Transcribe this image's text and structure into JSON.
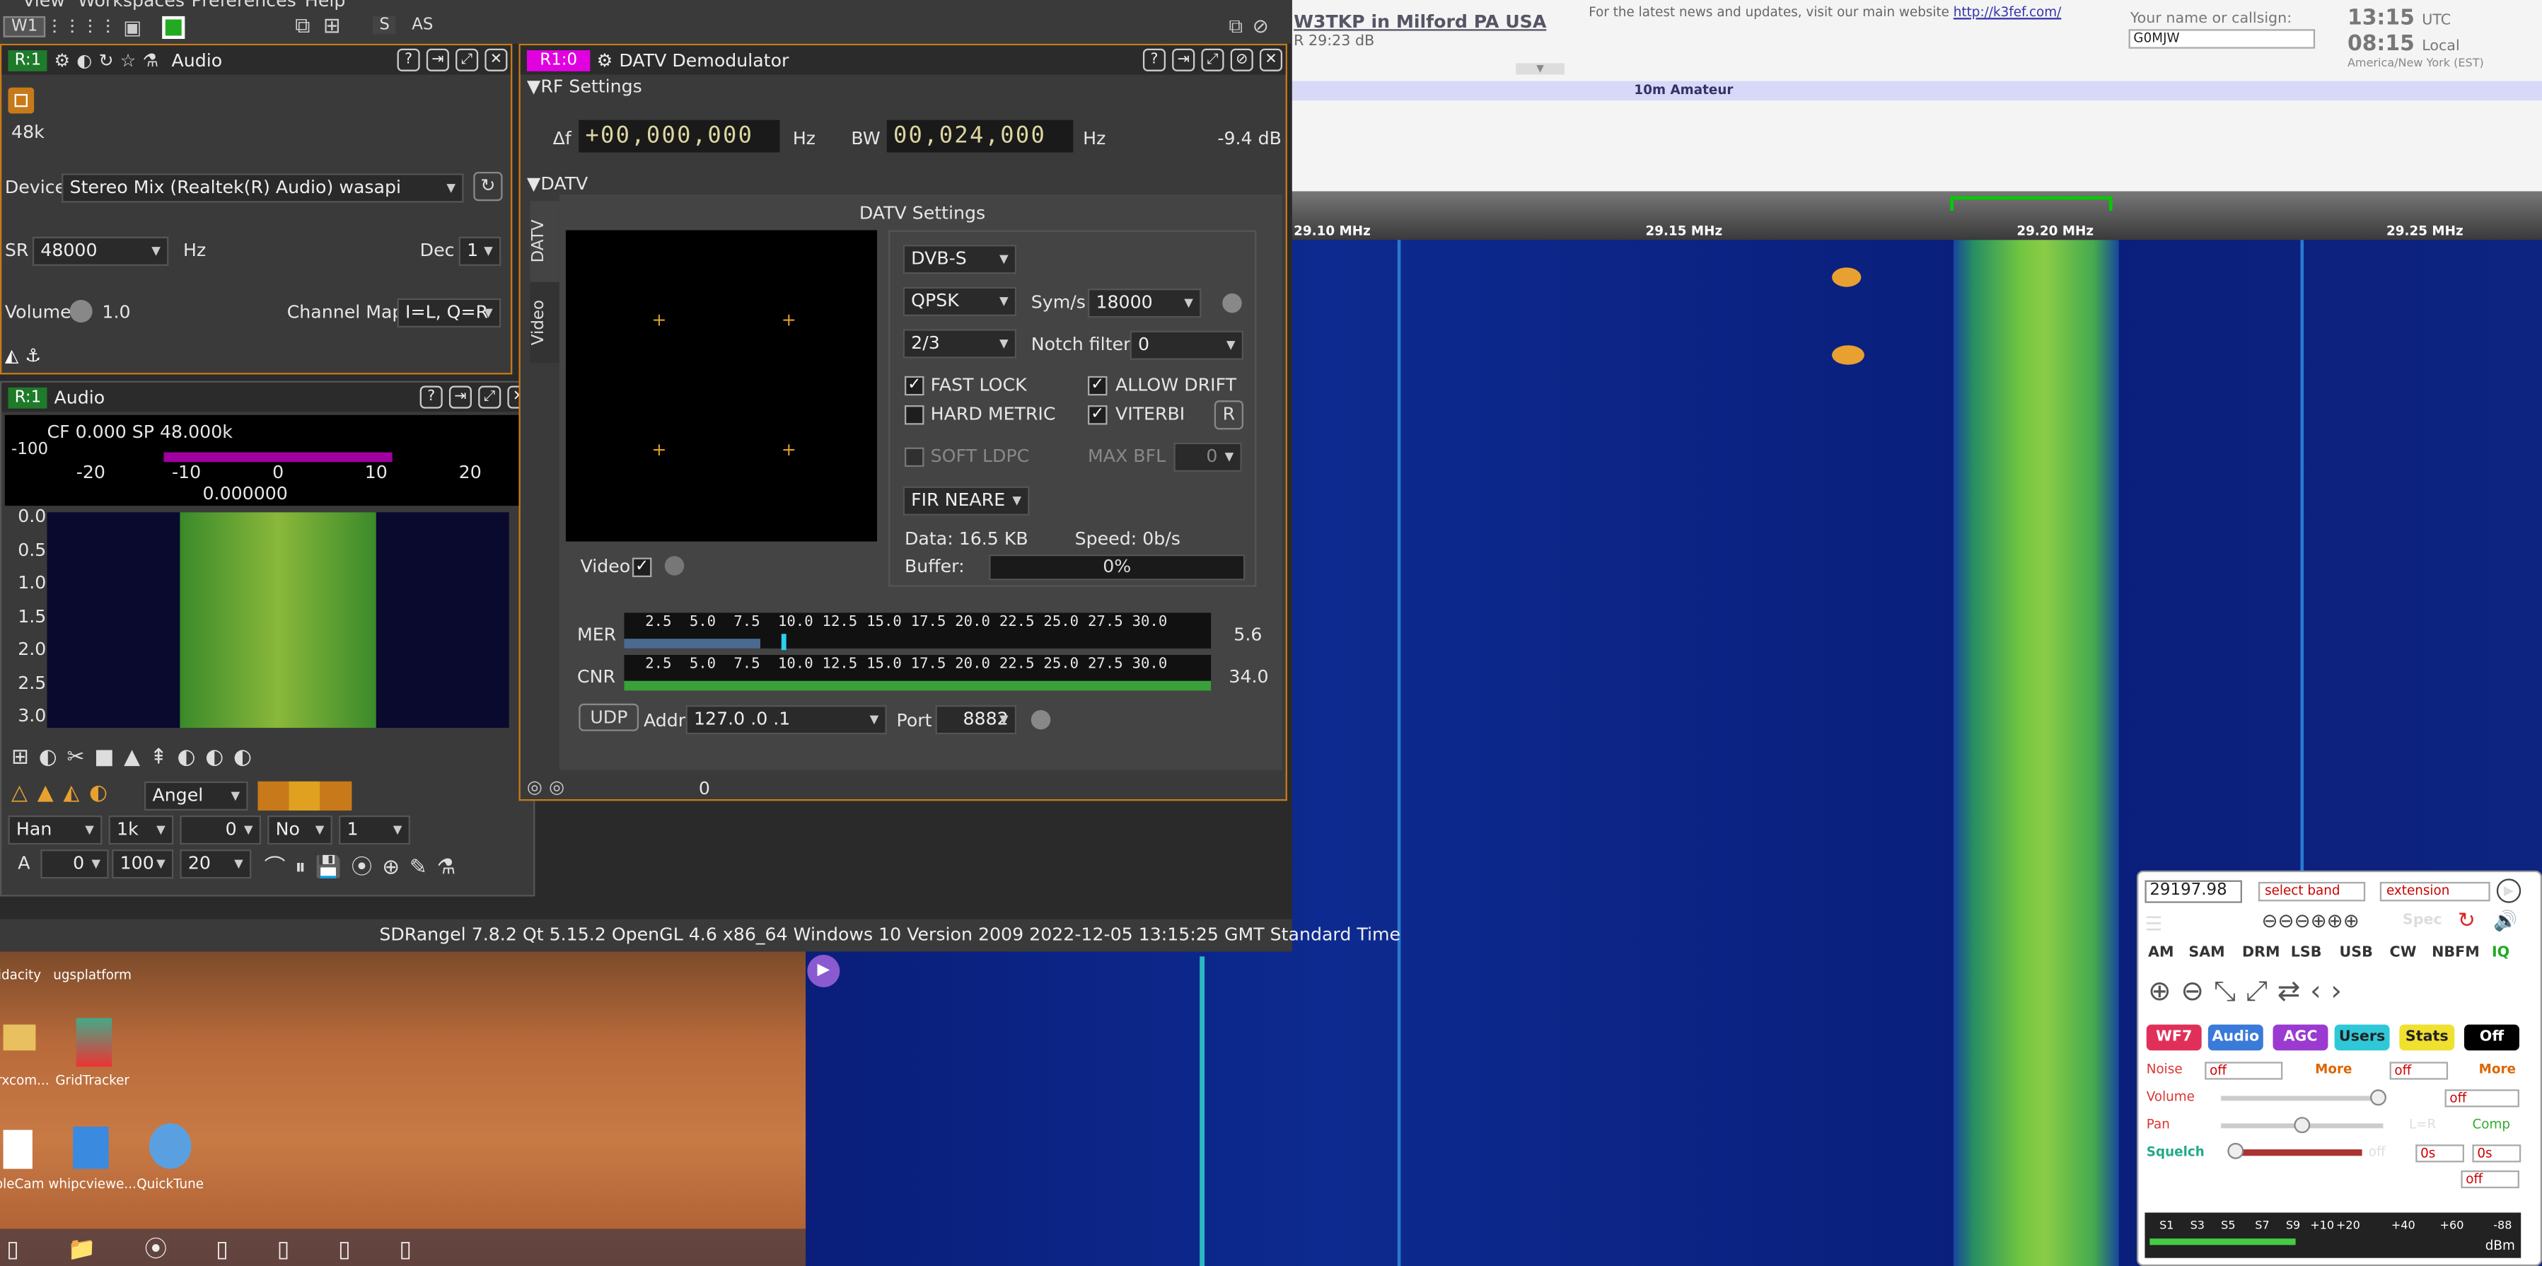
{
  "menubar": {
    "items": [
      "View",
      "Workspaces",
      "Preferences",
      "Help"
    ],
    "w1": "W1",
    "s": "S",
    "as": "AS"
  },
  "audio_panel": {
    "tag": "R:1",
    "title": "Audio",
    "rate": "48k",
    "device_label": "Device",
    "device": "Stereo Mix (Realtek(R) Audio) wasapi",
    "sr_label": "SR",
    "sr": "48000",
    "sr_unit": "Hz",
    "dec_label": "Dec",
    "dec": "1",
    "volume_label": "Volume",
    "volume": "1.0",
    "chmap_label": "Channel Map",
    "chmap": "I=L, Q=R"
  },
  "spectrum_panel": {
    "tag": "R:1",
    "title": "Audio",
    "cf": "CF 0.000 SP 48.000k",
    "db_top": "-100",
    "x_ticks": [
      "-20",
      "-10",
      "0",
      "10",
      "20"
    ],
    "center": "0.000000",
    "y_ticks": [
      "0.0",
      "0.5",
      "1.0",
      "1.5",
      "2.0",
      "2.5",
      "3.0"
    ],
    "window": "Han",
    "span": "1k",
    "offset": "0",
    "mode": "No",
    "n": "1",
    "avg": "0",
    "db": "100",
    "range": "20",
    "palette": "Angel",
    "a": "A"
  },
  "datv": {
    "tag": "R1:0",
    "title": "DATV Demodulator",
    "rf_section": "RF Settings",
    "df_label": "Δf",
    "df": "+00,000,000",
    "hz": "Hz",
    "bw_label": "BW",
    "bw": "00,024,000",
    "level": "-9.4 dB",
    "datv_section": "DATV",
    "tabs": [
      "DATV",
      "Video"
    ],
    "settings_title": "DATV Settings",
    "standard": "DVB-S",
    "modulation": "QPSK",
    "sym_label": "Sym/s",
    "sym": "18000",
    "fec": "2/3",
    "notch_label": "Notch filter",
    "notch": "0",
    "fast_lock": "FAST LOCK",
    "allow_drift": "ALLOW DRIFT",
    "hard_metric": "HARD METRIC",
    "viterbi": "VITERBI",
    "r": "R",
    "soft_ldpc": "SOFT LDPC",
    "max_bfl": "MAX BFL",
    "max_bfl_val": "0",
    "filter": "FIR NEARE",
    "data": "Data: 16.5 KB",
    "speed": "Speed: 0b/s",
    "buffer_label": "Buffer:",
    "buffer": "0%",
    "buffer_level": 0,
    "video_label": "Video",
    "mer_label": "MER",
    "mer": "5.6",
    "cnr_label": "CNR",
    "cnr": "34.0",
    "scale": [
      "2.5",
      "5.0",
      "7.5",
      "10.0",
      "12.5",
      "15.0",
      "17.5",
      "20.0",
      "22.5",
      "25.0",
      "27.5",
      "30.0"
    ],
    "udp": "UDP",
    "addr_label": "Addr",
    "addr": "127.0 .0 .1",
    "port_label": "Port",
    "port": "8882",
    "bottom_val": "0"
  },
  "status_bar": "SDRangel 7.8.2 Qt 5.15.2 OpenGL 4.6 x86_64 Windows 10 Version 2009  2022-12-05 13:15:25 GMT Standard Time",
  "websdr": {
    "station": "W3TKP in Milford PA USA",
    "snr": "R 29:23 dB",
    "news": "For the latest news and updates, visit our main website",
    "news_link": "http://k3fef.com/",
    "callsign_label": "Your name or callsign:",
    "callsign": "G0MJW",
    "utc_time": "13:15",
    "utc": "UTC",
    "local_time": "08:15",
    "local": "Local",
    "tz": "America/New York (EST)",
    "band": "10m Amateur",
    "freq_ticks": [
      "29.10 MHz",
      "29.15 MHz",
      "29.20 MHz",
      "29.25 MHz"
    ],
    "freq": "29197.98",
    "select_band": "select band",
    "extension": "extension",
    "spec": "Spec",
    "modes": [
      "AM",
      "SAM",
      "DRM",
      "LSB",
      "USB",
      "CW",
      "NBFM",
      "IQ"
    ],
    "row2": [
      "WF7",
      "Audio",
      "AGC",
      "Users",
      "Stats",
      "Off"
    ],
    "noise_label": "Noise",
    "off": "off",
    "more": "More",
    "volume_label": "Volume",
    "pan_label": "Pan",
    "lr": "L=R",
    "comp": "Comp",
    "squelch_label": "Squelch",
    "os": "0s",
    "smeter": [
      "S1",
      "S3",
      "S5",
      "S7",
      "S9",
      "+10",
      "+20",
      "+40",
      "+60",
      "-88"
    ],
    "dbm": "dBm",
    "colors": {
      "wf7": "#e0305a",
      "audio": "#3a7ad8",
      "agc": "#9a3ad0",
      "users": "#30c8d8",
      "stats": "#f0e030",
      "off": "#000000"
    }
  },
  "desktop": {
    "icons": [
      "idacity",
      "ugsplatform",
      "crxcom...",
      "GridTracker",
      "pleCam",
      "whipcviewe...",
      "QuickTune"
    ]
  }
}
